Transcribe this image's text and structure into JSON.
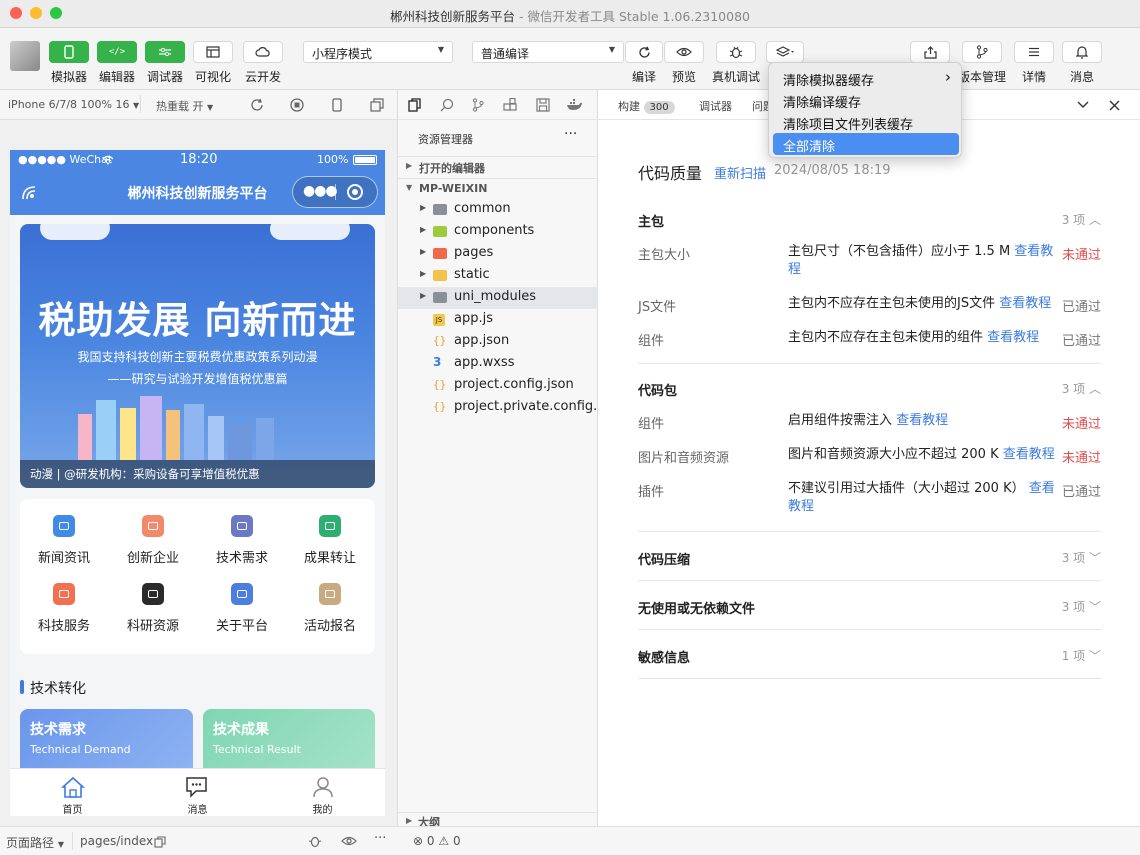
{
  "window": {
    "title": "郴州科技创新服务平台",
    "subtitle": "- 微信开发者工具 Stable 1.06.2310080"
  },
  "toolbar": {
    "simulator": "模拟器",
    "editor": "编辑器",
    "debugger": "调试器",
    "visual": "可视化",
    "cloud": "云开发",
    "mode_select": "小程序模式",
    "compile_select": "普通编译",
    "compile": "编译",
    "preview": "预览",
    "real_debug": "真机调试",
    "version": "版本管理",
    "details": "详情",
    "messages": "消息"
  },
  "dropdown": {
    "items": [
      "清除模拟器缓存",
      "清除编译缓存",
      "清除项目文件列表缓存",
      "全部清除"
    ],
    "submenu_arrow": "›"
  },
  "simbar": {
    "device": "iPhone 6/7/8 100% 16",
    "hotreload": "热重载 开"
  },
  "phone": {
    "carrier": "●●●●● WeChat",
    "time": "18:20",
    "battery": "100%",
    "nav_title": "郴州科技创新服务平台",
    "banner": {
      "title": "税助发展 向新而进",
      "sub1": "我国支持科技创新主要税费优惠政策系列动漫",
      "sub2": "——研究与试验开发增值税优惠篇",
      "caption": "动漫 | @研发机构：采购设备可享增值税优惠"
    },
    "grid": [
      {
        "label": "新闻资讯",
        "color": "#3f8be6",
        "icon": "news-icon"
      },
      {
        "label": "创新企业",
        "color": "#f08a6a",
        "icon": "enterprise-icon"
      },
      {
        "label": "技术需求",
        "color": "#6b78c4",
        "icon": "demand-icon"
      },
      {
        "label": "成果转让",
        "color": "#2fae74",
        "icon": "transfer-icon"
      },
      {
        "label": "科技服务",
        "color": "#f0704f",
        "icon": "service-icon"
      },
      {
        "label": "科研资源",
        "color": "#2b2b2b",
        "icon": "resource-icon"
      },
      {
        "label": "关于平台",
        "color": "#4a7fe0",
        "icon": "about-icon"
      },
      {
        "label": "活动报名",
        "color": "#c9a981",
        "icon": "activity-icon"
      }
    ],
    "section_title": "技术转化",
    "card1": {
      "title": "技术需求",
      "sub": "Technical Demand"
    },
    "card2": {
      "title": "技术成果",
      "sub": "Technical Result"
    },
    "tabs": [
      {
        "label": "首页",
        "icon": "home-icon"
      },
      {
        "label": "消息",
        "icon": "message-icon"
      },
      {
        "label": "我的",
        "icon": "user-icon"
      }
    ]
  },
  "explorer": {
    "title": "资源管理器",
    "open_editors": "打开的编辑器",
    "project": "MP-WEIXIN",
    "outline": "大纲",
    "files": [
      {
        "name": "common",
        "type": "folder",
        "color": "#8a8f98"
      },
      {
        "name": "components",
        "type": "folder",
        "color": "#9ccc3c"
      },
      {
        "name": "pages",
        "type": "folder",
        "color": "#f06a4a"
      },
      {
        "name": "static",
        "type": "folder",
        "color": "#f2c24a"
      },
      {
        "name": "uni_modules",
        "type": "folder",
        "color": "#8a8f98"
      },
      {
        "name": "app.js",
        "type": "js",
        "color": "#f2c84b"
      },
      {
        "name": "app.json",
        "type": "json",
        "color": "#e8a33b"
      },
      {
        "name": "app.wxss",
        "type": "wxss",
        "color": "#3a7fe0"
      },
      {
        "name": "project.config.json",
        "type": "json",
        "color": "#e8a33b"
      },
      {
        "name": "project.private.config...",
        "type": "json",
        "color": "#e8a33b"
      }
    ]
  },
  "main": {
    "tabs": {
      "build": "构建",
      "build_count": "300",
      "debugger": "调试器",
      "problems": "问题"
    },
    "header": {
      "title": "代码质量",
      "rescan": "重新扫描",
      "date": "2024/08/05 18:19"
    },
    "sections": {
      "main_pkg": {
        "title": "主包",
        "count": "3 项"
      },
      "code_pkg": {
        "title": "代码包",
        "count": "3 项"
      },
      "compress": {
        "title": "代码压缩",
        "count": "3 项"
      },
      "unused": {
        "title": "无使用或无依赖文件",
        "count": "3 项"
      },
      "sensitive": {
        "title": "敏感信息",
        "count": "1 项"
      }
    },
    "rows": {
      "r1": {
        "label": "主包大小",
        "desc": "主包尺寸（不包含插件）应小于 1.5 M",
        "link": "查看教程",
        "status": "未通过"
      },
      "r2": {
        "label": "JS文件",
        "desc": "主包内不应存在主包未使用的JS文件",
        "link": "查看教程",
        "status": "已通过"
      },
      "r3": {
        "label": "组件",
        "desc": "主包内不应存在主包未使用的组件",
        "link": "查看教程",
        "status": "已通过"
      },
      "r4": {
        "label": "组件",
        "desc": "启用组件按需注入",
        "link": "查看教程",
        "status": "未通过"
      },
      "r5": {
        "label": "图片和音频资源",
        "desc": "图片和音频资源大小应不超过 200 K",
        "link": "查看教程",
        "status": "未通过"
      },
      "r6": {
        "label": "插件",
        "desc": "不建议引用过大插件（大小超过 200 K）",
        "link": "查看教程",
        "status": "已通过"
      }
    }
  },
  "footer": {
    "page_path_label": "页面路径",
    "page_path": "pages/index",
    "errors": "0",
    "warnings": "0"
  }
}
